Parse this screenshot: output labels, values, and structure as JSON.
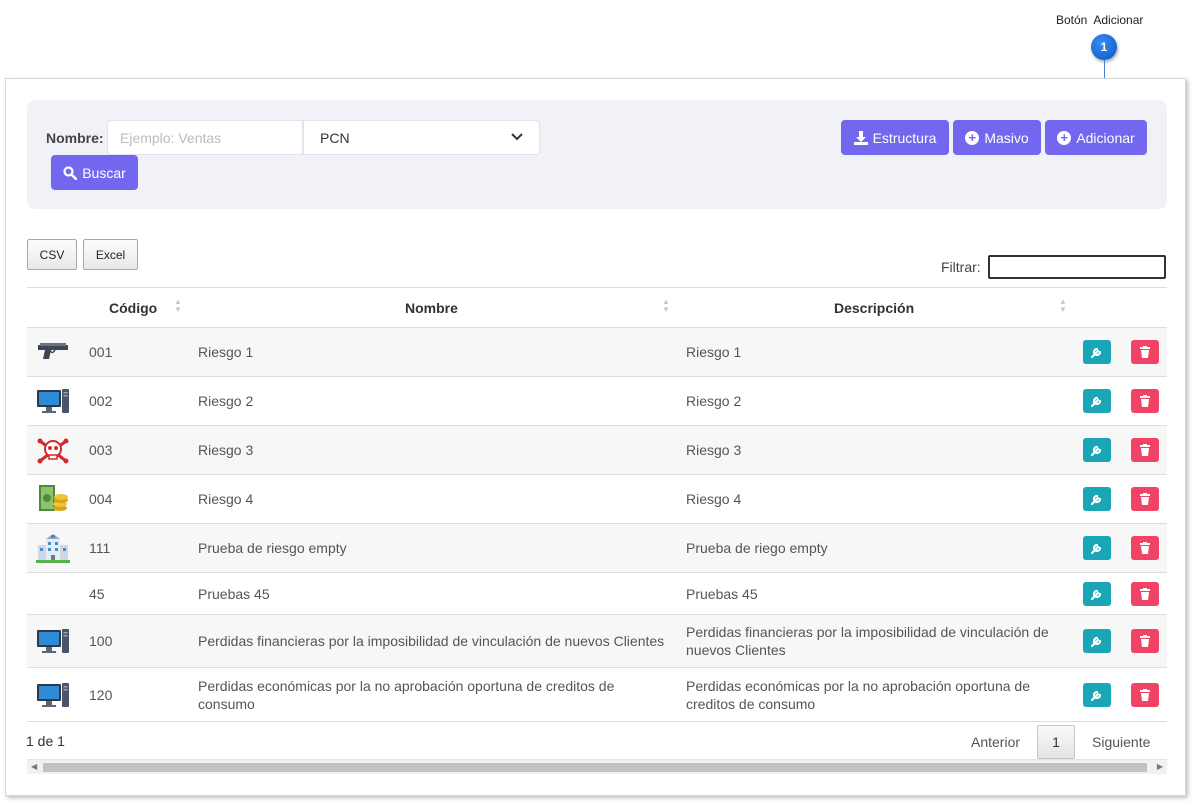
{
  "callout": {
    "label": "Botón  Adicionar",
    "number": "1"
  },
  "filter": {
    "nombre_label": "Nombre:",
    "nombre_placeholder": "Ejemplo: Ventas",
    "select_value": "PCN",
    "buscar_label": "Buscar",
    "estructura_label": "Estructura",
    "masivo_label": "Masivo",
    "adicionar_label": "Adicionar"
  },
  "export": {
    "csv_label": "CSV",
    "excel_label": "Excel"
  },
  "filtrar_label": "Filtrar:",
  "table": {
    "headers": {
      "codigo": "Código",
      "nombre": "Nombre",
      "descripcion": "Descripción"
    },
    "rows": [
      {
        "icon": "pistol-icon",
        "codigo": "001",
        "nombre": "Riesgo 1",
        "descripcion": "Riesgo 1"
      },
      {
        "icon": "computer-icon",
        "codigo": "002",
        "nombre": "Riesgo 2",
        "descripcion": "Riesgo 2"
      },
      {
        "icon": "skull-crossbones-icon",
        "codigo": "003",
        "nombre": "Riesgo 3",
        "descripcion": "Riesgo 3"
      },
      {
        "icon": "money-coins-icon",
        "codigo": "004",
        "nombre": "Riesgo 4",
        "descripcion": "Riesgo 4"
      },
      {
        "icon": "building-icon",
        "codigo": "111",
        "nombre": "Prueba de riesgo empty",
        "descripcion": "Prueba de riego empty"
      },
      {
        "icon": "",
        "codigo": "45",
        "nombre": "Pruebas 45",
        "descripcion": "Pruebas 45"
      },
      {
        "icon": "computer-icon",
        "codigo": "100",
        "nombre": "Perdidas financieras por la imposibilidad de vinculación de nuevos Clientes",
        "descripcion": "Perdidas financieras por la imposibilidad de vinculación de nuevos Clientes"
      },
      {
        "icon": "computer-icon",
        "codigo": "120",
        "nombre": "Perdidas económicas por la no aprobación oportuna de creditos de consumo",
        "descripcion": "Perdidas económicas por la no aprobación oportuna de creditos de consumo"
      }
    ]
  },
  "pagination": {
    "info": "1 de 1",
    "prev": "Anterior",
    "current": "1",
    "next": "Siguiente"
  },
  "colors": {
    "primary": "#7367f0",
    "edit": "#1aa6b7",
    "delete": "#f04366",
    "callout": "#1466d6"
  }
}
